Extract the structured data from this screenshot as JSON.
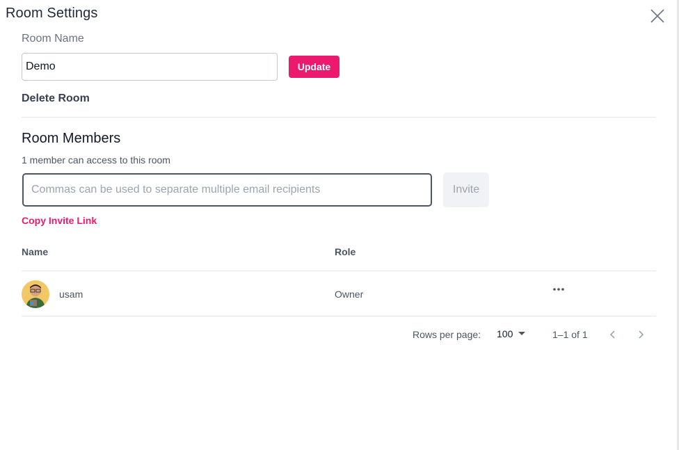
{
  "dialog": {
    "title": "Room Settings",
    "close_icon": "close-icon"
  },
  "room": {
    "name_label": "Room Name",
    "name_value": "Demo",
    "update_label": "Update",
    "delete_label": "Delete Room"
  },
  "members": {
    "title": "Room Members",
    "subtitle": "1 member can access to this room",
    "invite_placeholder": "Commas can be used to separate multiple email recipients",
    "invite_value": "",
    "invite_label": "Invite",
    "copy_link_label": "Copy Invite Link"
  },
  "table": {
    "columns": [
      "Name",
      "Role"
    ],
    "rows": [
      {
        "name": "usam",
        "role": "Owner",
        "avatar": "user-avatar",
        "actions_icon": "more-horizontal-icon"
      }
    ],
    "pagination": {
      "rows_per_page_label": "Rows per page:",
      "rows_per_page_value": "100",
      "range_text": "1–1 of 1"
    }
  },
  "colors": {
    "accent": "#ec1a6e",
    "text_muted": "#4b5563",
    "divider": "#e5e7eb"
  }
}
